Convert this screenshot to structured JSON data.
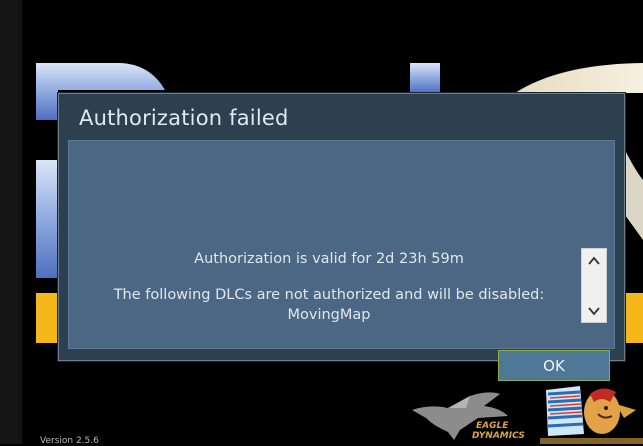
{
  "dialog": {
    "title": "Authorization failed",
    "message_line1": "Authorization is valid for 2d 23h 59m",
    "message_line2": "The following DLCs are not authorized and will be disabled:",
    "message_line3": "MovingMap",
    "ok_label": "OK"
  },
  "background": {
    "logo_left_text_line1": "EAGLE",
    "logo_left_text_line2": "DYNAMICS",
    "version_text": "Version 2.5.6"
  },
  "colors": {
    "dialog_frame": "#2d4050",
    "dialog_body": "#4b6784",
    "ok_border": "#8faf46",
    "banner_yellow": "#f4b81a"
  }
}
